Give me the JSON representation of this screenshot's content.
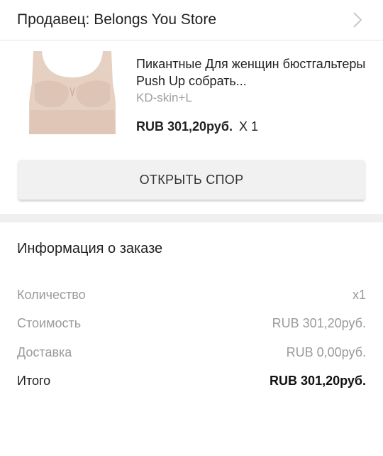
{
  "seller": {
    "title": "Продавец: Belongs You Store"
  },
  "product": {
    "title": "Пикантные Для женщин бюстгальтеры Push Up собрать...",
    "variant": "KD-skin+L",
    "price": "RUB 301,20руб.",
    "quantity": "X 1"
  },
  "actions": {
    "open_dispute": "ОТКРЫТЬ СПОР"
  },
  "order_info": {
    "title": "Информация о заказе",
    "rows": [
      {
        "label": "Количество",
        "value": "x1"
      },
      {
        "label": "Стоимость",
        "value": "RUB 301,20руб."
      },
      {
        "label": "Доставка",
        "value": "RUB 0,00руб."
      },
      {
        "label": "Итого",
        "value": "RUB 301,20руб."
      }
    ]
  },
  "colors": {
    "accent_text": "#212121",
    "muted_text": "#9a9a9a",
    "button_bg": "#f1f1f1",
    "product_skin": "#e6cfc0"
  },
  "icons": {
    "seller_arrow": "chevron-right-icon"
  }
}
